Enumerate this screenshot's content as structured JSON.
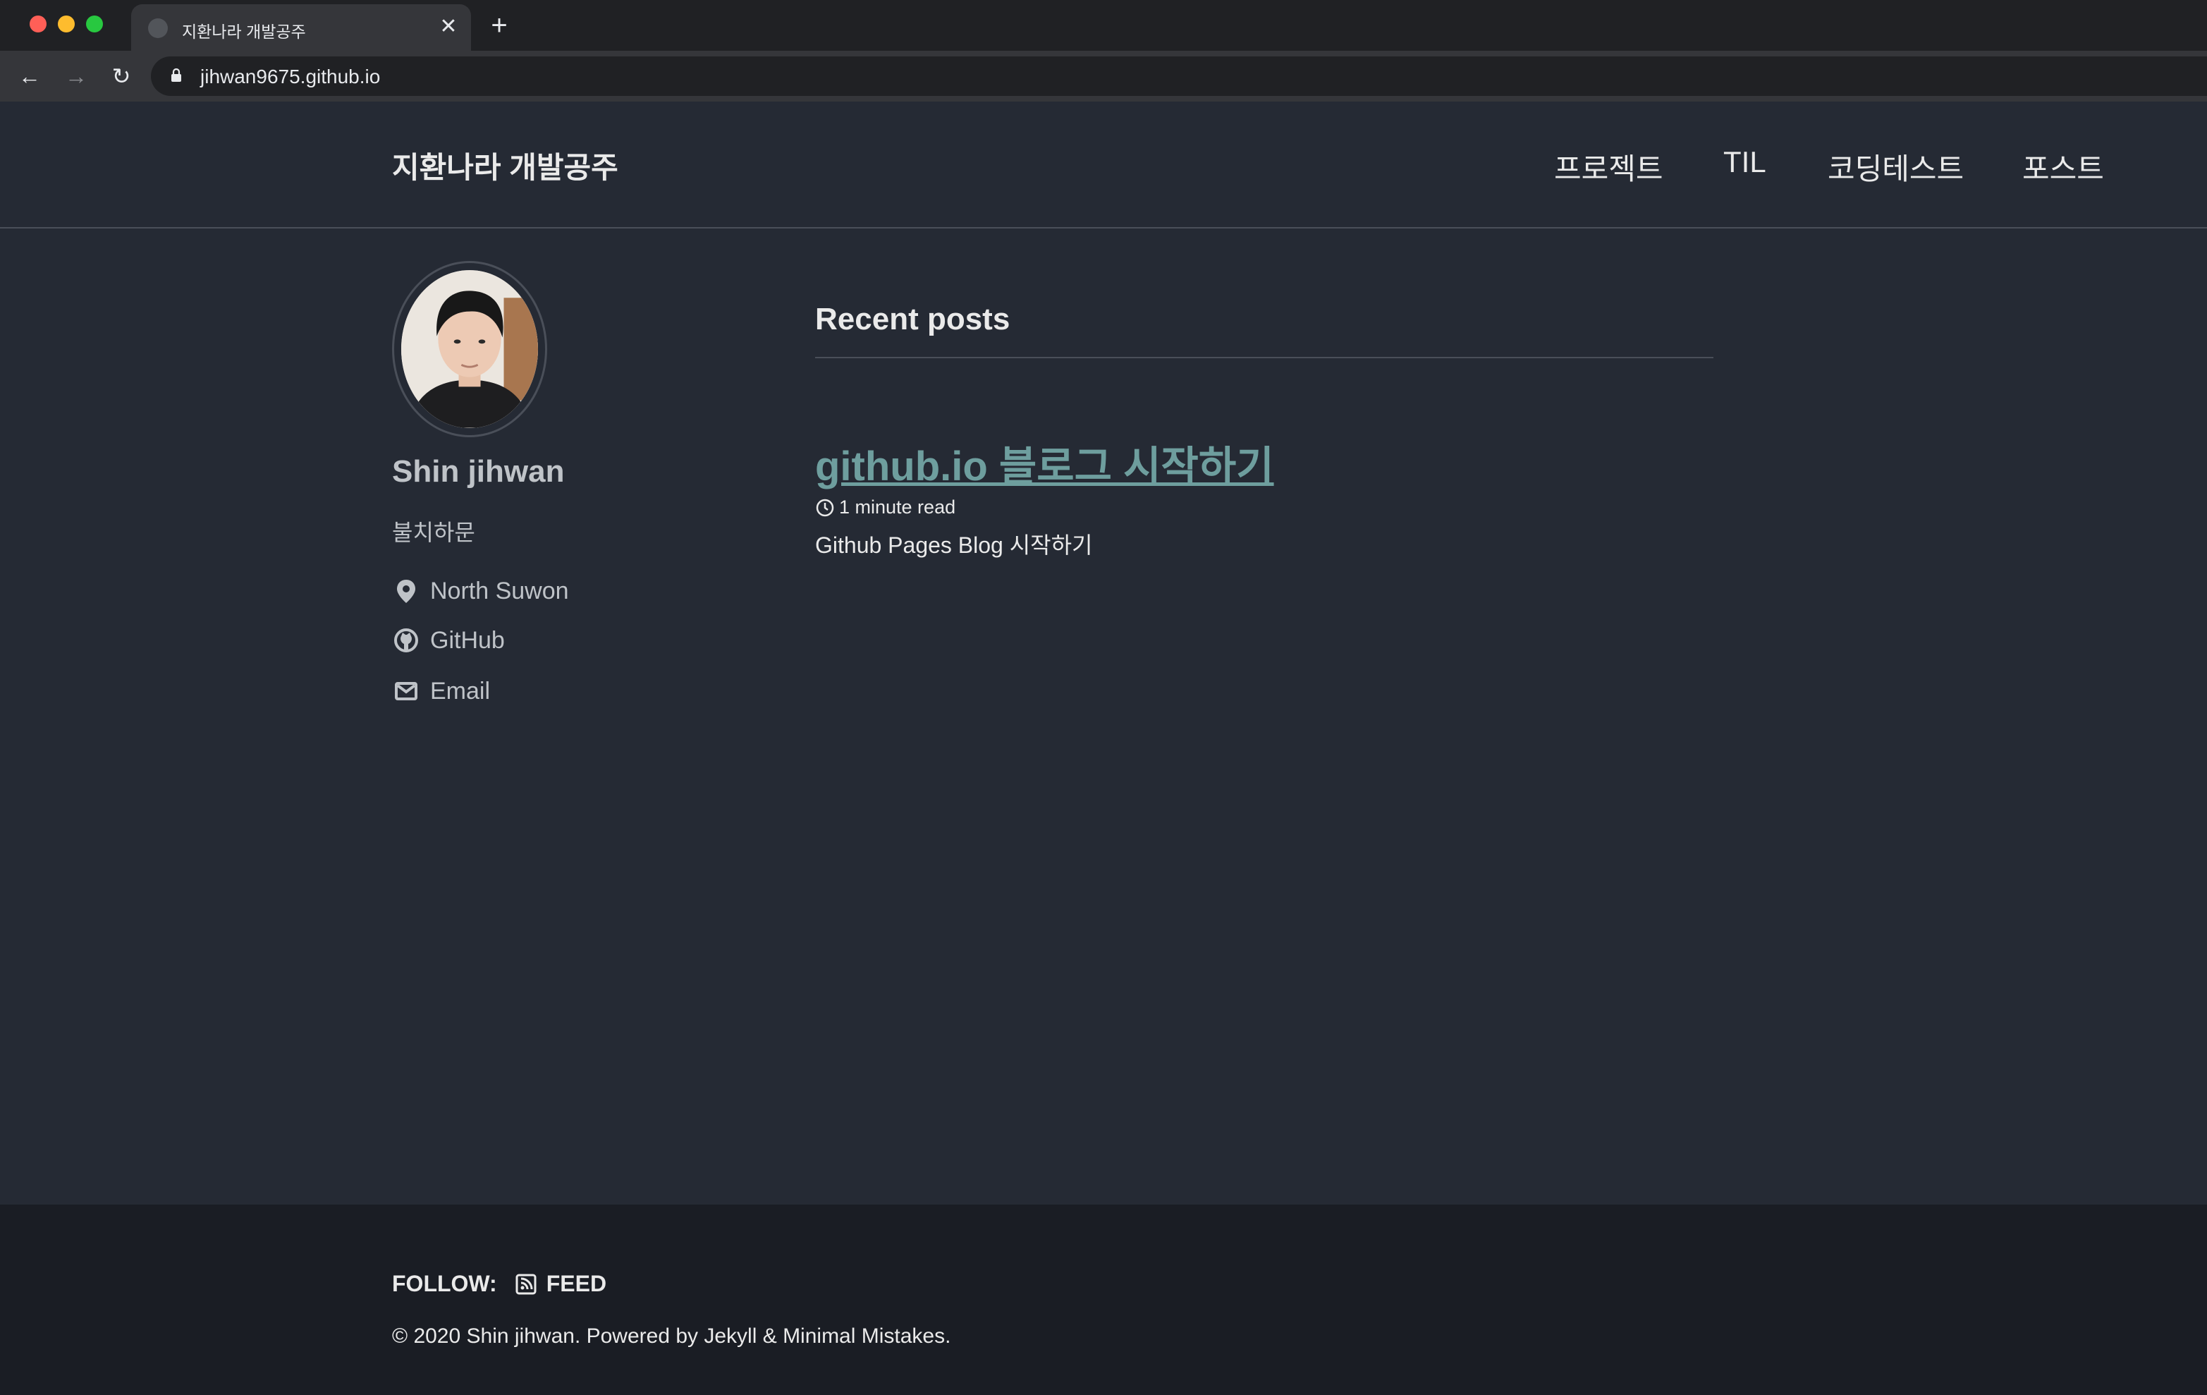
{
  "browser": {
    "tab_title": "지환나라 개발공주",
    "close_glyph": "✕",
    "new_tab_glyph": "+",
    "back_glyph": "←",
    "forward_glyph": "→",
    "reload_glyph": "↻",
    "url": "jihwan9675.github.io"
  },
  "masthead": {
    "site_title": "지환나라 개발공주",
    "nav": [
      {
        "label": "프로젝트"
      },
      {
        "label": "TIL"
      },
      {
        "label": "코딩테스트"
      },
      {
        "label": "포스트"
      }
    ]
  },
  "sidebar": {
    "name": "Shin jihwan",
    "bio": "불치하문",
    "location": "North Suwon",
    "github": "GitHub",
    "email": "Email"
  },
  "main": {
    "section_title": "Recent posts",
    "posts": [
      {
        "title": "github.io 블로그 시작하기",
        "read_time": "1 minute read",
        "excerpt": "Github Pages Blog 시작하기"
      }
    ]
  },
  "footer": {
    "follow_label": "FOLLOW:",
    "feed_label": "FEED",
    "copyright": "© 2020 Shin jihwan. Powered by Jekyll & Minimal Mistakes."
  },
  "colors": {
    "page_bg": "#252a34",
    "footer_bg": "#1a1d24",
    "link": "#6e9e9e",
    "text": "#eaeaea"
  }
}
